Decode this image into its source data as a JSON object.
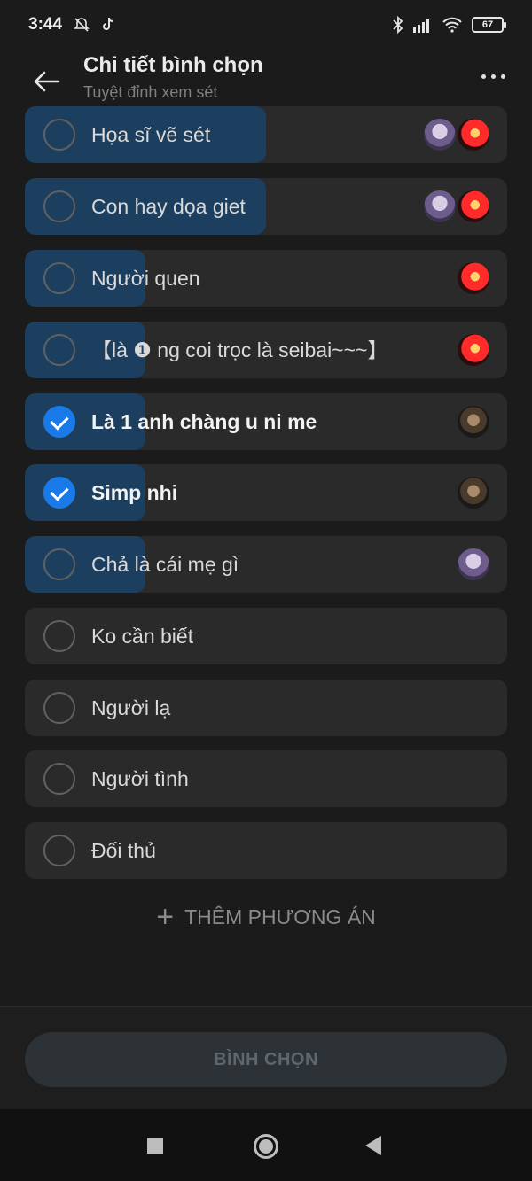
{
  "status_bar": {
    "time": "3:44",
    "battery": "67"
  },
  "header": {
    "title": "Chi tiết bình chọn",
    "subtitle": "Tuyệt đỉnh xem sét"
  },
  "options": [
    {
      "label": "Họa sĩ vẽ sét",
      "checked": false,
      "vote_fraction": 0.5,
      "avatars": [
        "av-purple",
        "av-red"
      ]
    },
    {
      "label": "Con hay dọa giet",
      "checked": false,
      "vote_fraction": 0.5,
      "avatars": [
        "av-purple",
        "av-red"
      ]
    },
    {
      "label": "Người quen",
      "checked": false,
      "vote_fraction": 0.25,
      "avatars": [
        "av-red"
      ]
    },
    {
      "label": "【là ❶ ng coi trọc là seibai~~~】",
      "checked": false,
      "vote_fraction": 0.25,
      "avatars": [
        "av-red"
      ]
    },
    {
      "label": "Là 1 anh chàng u ni me",
      "checked": true,
      "vote_fraction": 0.25,
      "avatars": [
        "av-dark"
      ]
    },
    {
      "label": "Simp nhi",
      "checked": true,
      "vote_fraction": 0.25,
      "avatars": [
        "av-dark"
      ]
    },
    {
      "label": "Chả là cái mẹ gì",
      "checked": false,
      "vote_fraction": 0.25,
      "avatars": [
        "av-purple"
      ]
    },
    {
      "label": "Ko cần biết",
      "checked": false,
      "vote_fraction": 0,
      "avatars": []
    },
    {
      "label": "Người lạ",
      "checked": false,
      "vote_fraction": 0,
      "avatars": []
    },
    {
      "label": "Người tình",
      "checked": false,
      "vote_fraction": 0,
      "avatars": []
    },
    {
      "label": "Đối thủ",
      "checked": false,
      "vote_fraction": 0,
      "avatars": []
    }
  ],
  "add_option": {
    "plus": "+",
    "label": "THÊM PHƯƠNG ÁN"
  },
  "vote_button": {
    "label": "BÌNH CHỌN"
  },
  "colors": {
    "accent": "#1a7be8",
    "fill": "#1d3f5f",
    "option_bg": "#2a2a2a"
  }
}
